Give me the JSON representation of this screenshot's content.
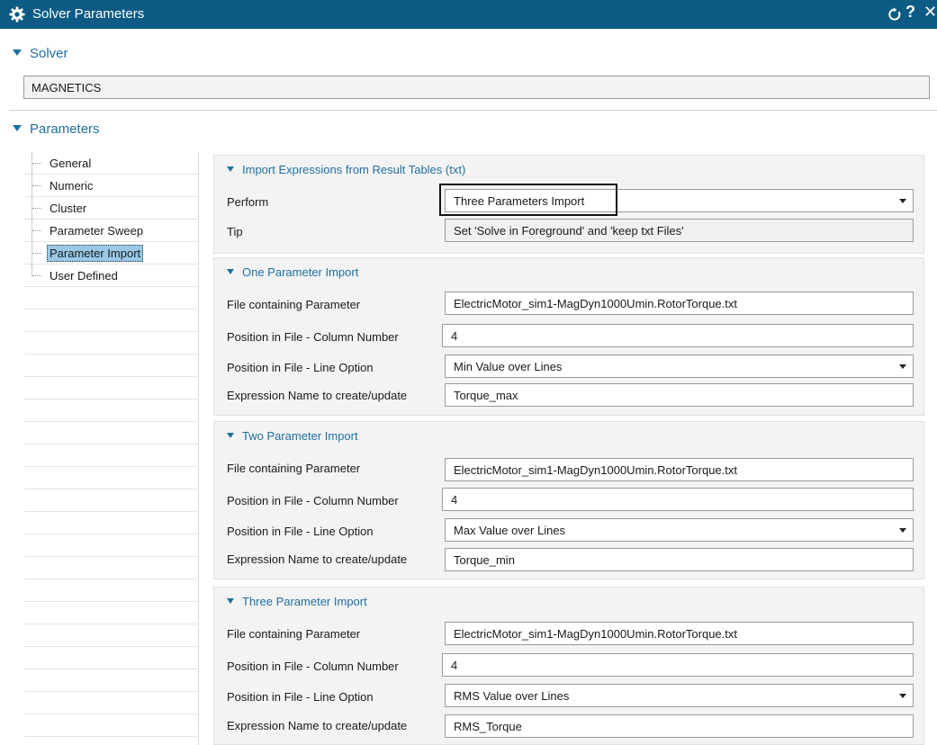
{
  "window": {
    "title": "Solver Parameters"
  },
  "solver": {
    "header": "Solver",
    "value": "MAGNETICS"
  },
  "parameters": {
    "header": "Parameters"
  },
  "tree": [
    {
      "label": "General"
    },
    {
      "label": "Numeric"
    },
    {
      "label": "Cluster"
    },
    {
      "label": "Parameter Sweep"
    },
    {
      "label": "Parameter Import",
      "selected": true
    },
    {
      "label": "User Defined"
    }
  ],
  "import_section": {
    "header": "Import Expressions from Result Tables (txt)",
    "perform_label": "Perform",
    "perform_value": "Three Parameters Import",
    "tip_label": "Tip",
    "tip_value": "Set 'Solve in Foreground' and 'keep txt Files'"
  },
  "one_param": {
    "header": "One Parameter Import",
    "file_label": "File containing Parameter",
    "file_value": "ElectricMotor_sim1-MagDyn1000Umin.RotorTorque.txt",
    "column_label": "Position in File - Column Number",
    "column_value": "4",
    "line_label": "Position in File - Line Option",
    "line_value": "Min Value over Lines",
    "expr_label": "Expression Name to create/update",
    "expr_value": "Torque_max"
  },
  "two_param": {
    "header": "Two Parameter Import",
    "file_label": "File containing Parameter",
    "file_value": "ElectricMotor_sim1-MagDyn1000Umin.RotorTorque.txt",
    "column_label": "Position in File - Column Number",
    "column_value": "4",
    "line_label": "Position in File - Line Option",
    "line_value": "Max Value over Lines",
    "expr_label": "Expression Name to create/update",
    "expr_value": "Torque_min"
  },
  "three_param": {
    "header": "Three Parameter Import",
    "file_label": "File containing Parameter",
    "file_value": "ElectricMotor_sim1-MagDyn1000Umin.RotorTorque.txt",
    "column_label": "Position in File - Column Number",
    "column_value": "4",
    "line_label": "Position in File - Line Option",
    "line_value": "RMS Value over Lines",
    "expr_label": "Expression Name to create/update",
    "expr_value": "RMS_Torque"
  },
  "colors": {
    "titlebar": "#0d5b84",
    "accent": "#1f6fa0",
    "selection": "#99c9e6"
  },
  "icons": {
    "title": "gear-icon",
    "reset": "reset-icon",
    "help": "help-icon",
    "close": "close-icon"
  }
}
